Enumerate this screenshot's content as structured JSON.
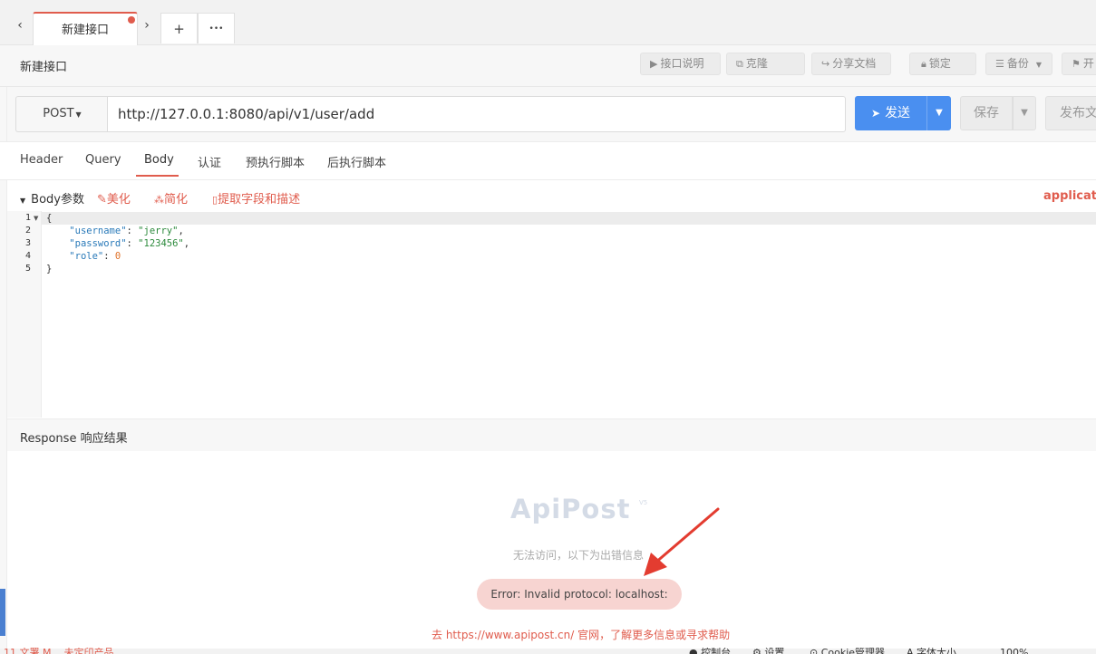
{
  "tabs": {
    "active_label": "新建接口",
    "add_label": "+",
    "more_label": "•••"
  },
  "header": {
    "page_title": "新建接口",
    "tools": [
      {
        "label": "接口说明",
        "icon": "play-icon"
      },
      {
        "label": "克隆",
        "icon": "copy-icon"
      },
      {
        "label": "分享文档",
        "icon": "share-icon"
      },
      {
        "label": "锁定",
        "icon": "lock-icon"
      },
      {
        "label": "备份",
        "icon": "database-icon"
      },
      {
        "label": "开",
        "icon": "flag-icon"
      }
    ]
  },
  "request": {
    "method": "POST",
    "url": "http://127.0.0.1:8080/api/v1/user/add",
    "send_label": "发送",
    "save_label": "保存",
    "publish_label": "发布文"
  },
  "subtabs": [
    "Header",
    "Query",
    "Body",
    "认证",
    "预执行脚本",
    "后执行脚本"
  ],
  "active_subtab": "Body",
  "body_bar": {
    "label": "Body参数",
    "beautify": "美化",
    "simplify": "简化",
    "extract": "提取字段和描述",
    "content_type": "applicatio"
  },
  "editor": {
    "line_numbers": [
      "1",
      "2",
      "3",
      "4",
      "5"
    ],
    "open_brace": "{",
    "close_brace": "}",
    "fields": [
      {
        "key": "\"username\"",
        "value": "\"jerry\"",
        "suffix": ","
      },
      {
        "key": "\"password\"",
        "value": "\"123456\"",
        "suffix": ","
      },
      {
        "key": "\"role\"",
        "value": "0",
        "suffix": ""
      }
    ]
  },
  "response": {
    "title": "Response 响应结果",
    "logo": "ApiPost",
    "logo_sup": "V5",
    "hint": "无法访问，以下为出错信息",
    "error": "Error: Invalid protocol: localhost:",
    "help": "去 https://www.apipost.cn/ 官网，了解更多信息或寻求帮助"
  },
  "status_bar": {
    "left": "11 文署 M... 未定印产品",
    "right": [
      "● 控制台",
      "⚙ 设置",
      "⊙ Cookie管理器",
      "A 字体大小",
      "100%"
    ]
  },
  "colors": {
    "accent": "#e05c4d",
    "primary": "#4a8ff0",
    "error_bg": "#f7d4d1"
  }
}
